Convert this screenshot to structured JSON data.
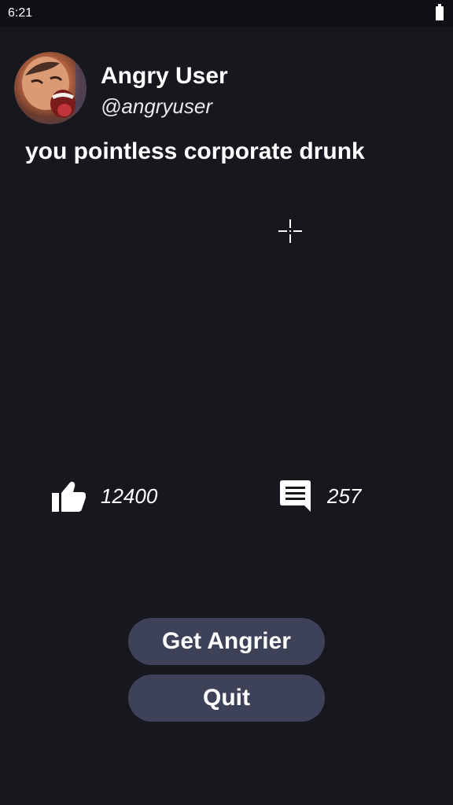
{
  "status_bar": {
    "time": "6:21",
    "battery_icon": "battery-icon"
  },
  "profile": {
    "name": "Angry User",
    "handle": "@angryuser",
    "avatar_icon": "screaming-face-avatar"
  },
  "post": {
    "text": "you pointless corporate drunk"
  },
  "stats": {
    "likes": "12400",
    "likes_icon": "thumbs-up-icon",
    "comments": "257",
    "comments_icon": "comment-icon"
  },
  "buttons": {
    "get_angrier": "Get Angrier",
    "quit": "Quit"
  },
  "colors": {
    "background": "#17181e",
    "status_bar": "#0f1013",
    "button": "#3d4258",
    "text": "#ffffff"
  }
}
